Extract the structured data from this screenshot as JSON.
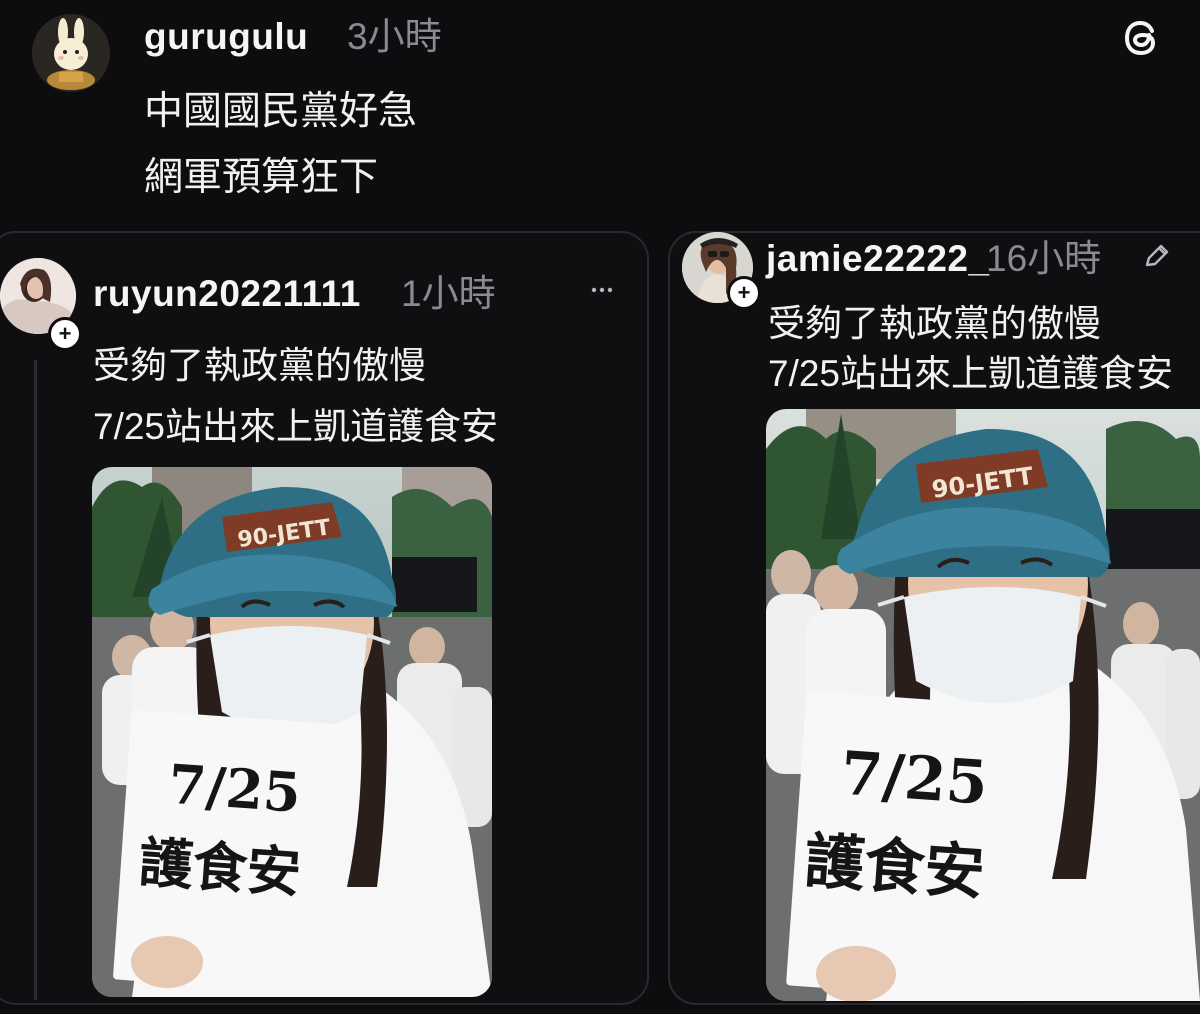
{
  "main_post": {
    "username": "gurugulu",
    "time": "3小時",
    "lines": [
      "中國國民黨好急",
      "網軍預算狂下"
    ],
    "logo_icon": "threads-logo-icon"
  },
  "quoted_posts": [
    {
      "username": "ruyun20221111",
      "time": "1小時",
      "lines": [
        "受夠了執政黨的傲慢",
        "7/25站出來上凱道護食安"
      ],
      "menu_icon": "more-options-icon",
      "sign_lines": [
        "7/25",
        "護食安"
      ]
    },
    {
      "username": "jamie22222_",
      "time": "16小時",
      "lines": [
        "受夠了執政黨的傲慢",
        "7/25站出來上凱道護食安"
      ],
      "menu_icon": "edit-pencil-icon",
      "sign_lines": [
        "7/25",
        "護食安"
      ]
    }
  ],
  "colors": {
    "background": "#0d0d0f",
    "text": "#f1f1f1",
    "muted": "#8a8a8f",
    "card_border": "#2a2a2e",
    "cap": "#2e6f86",
    "mask": "#ecf0f3"
  }
}
